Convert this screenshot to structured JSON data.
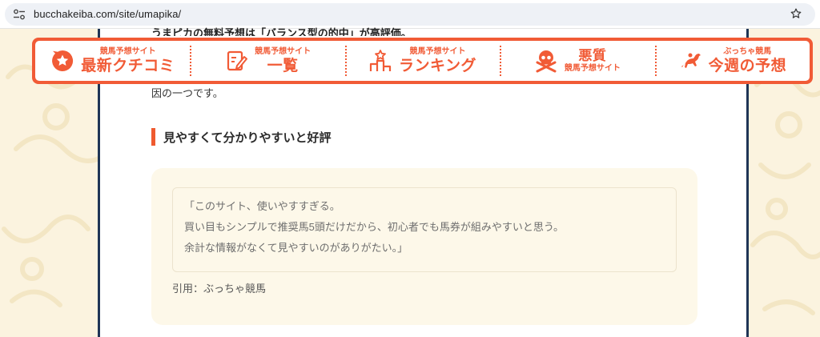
{
  "browser": {
    "url": "bucchakeiba.com/site/umapika/",
    "tune_icon": "site-info-icon",
    "bookmark_icon": "star-icon"
  },
  "colors": {
    "accent": "#f15b36",
    "column_border": "#1f3556",
    "page_bg": "#fbf3df",
    "review_bg": "#fdf8e9"
  },
  "nav": {
    "items": [
      {
        "small": "競馬予想サイト",
        "big": "最新クチコミ",
        "icon": "star-badge-icon"
      },
      {
        "small": "競馬予想サイト",
        "big": "一覧",
        "icon": "clipboard-pen-icon"
      },
      {
        "small": "競馬予想サイト",
        "big": "ランキング",
        "icon": "podium-icon"
      },
      {
        "big": "悪質",
        "small": "競馬予想サイト",
        "icon": "skull-icon"
      },
      {
        "small": "ぶっちゃ競馬",
        "big": "今週の予想",
        "icon": "racehorse-icon"
      }
    ]
  },
  "article": {
    "cut_line": "うまピカの無料予想は「バランス型の的中」が高評価。",
    "sentence_end": "因の一つです。",
    "heading": "見やすくて分かりやすいと好評",
    "quote_lines": [
      "「このサイト、使いやすすぎる。",
      "買い目もシンプルで推奨馬5頭だけだから、初心者でも馬券が組みやすいと思う。",
      "余計な情報がなくて見やすいのがありがたい。」"
    ],
    "citation": "引用：ぶっちゃ競馬"
  }
}
